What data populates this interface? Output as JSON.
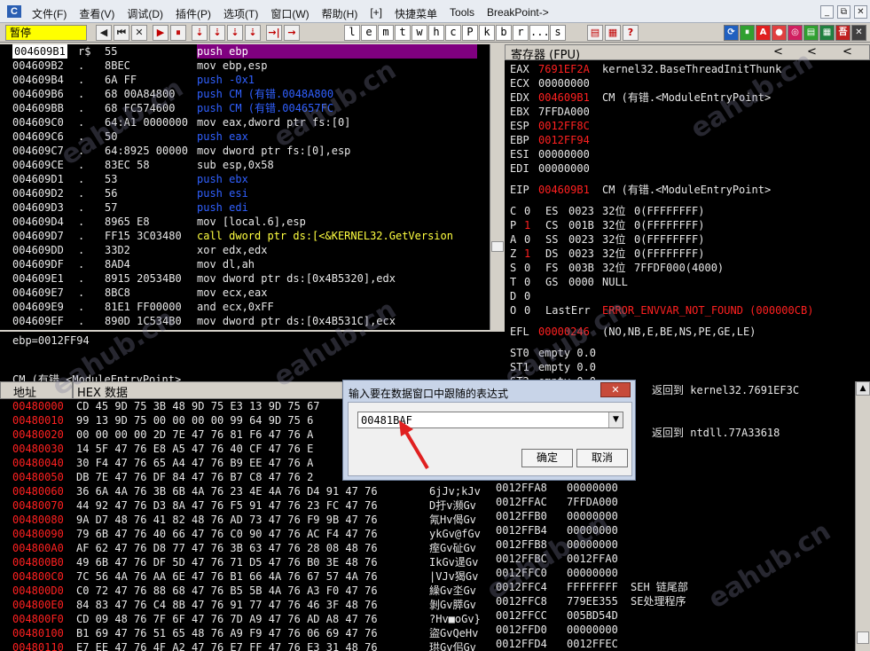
{
  "menubar": {
    "items": [
      "文件(F)",
      "查看(V)",
      "调试(D)",
      "插件(P)",
      "选项(T)",
      "窗口(W)",
      "帮助(H)",
      "[+]",
      "快捷菜单",
      "Tools",
      "BreakPoint->"
    ],
    "window_controls": [
      "_",
      "⧉",
      "✕"
    ]
  },
  "toolbar": {
    "status": "暂停",
    "debug_buttons": [
      "◀",
      "⏮",
      "✕",
      "▶",
      "⏸",
      "⇣",
      "⇣",
      "⇣",
      "⇣",
      "→|",
      "→"
    ],
    "letter_buttons": [
      "l",
      "e",
      "m",
      "t",
      "w",
      "h",
      "c",
      "P",
      "k",
      "b",
      "r",
      "...",
      "s"
    ],
    "tool_buttons": [
      "▤",
      "▦",
      "?"
    ],
    "right_icons": [
      "⟳",
      "⏸",
      "A",
      "●",
      "◎",
      "▤",
      "▦",
      "吾",
      "✕"
    ]
  },
  "disasm": {
    "rows": [
      {
        "addr": "004609B1",
        "mark": "r$",
        "hex": "55",
        "asm": "push ebp"
      },
      {
        "addr": "004609B2",
        "mark": ".",
        "hex": "8BEC",
        "asm": "mov ebp,esp"
      },
      {
        "addr": "004609B4",
        "mark": ".",
        "hex": "6A FF",
        "asm": "push -0x1"
      },
      {
        "addr": "004609B6",
        "mark": ".",
        "hex": "68 00A84800",
        "asm": "push CM (有错.0048A800"
      },
      {
        "addr": "004609BB",
        "mark": ".",
        "hex": "68 FC574600",
        "asm": "push CM (有错.004657FC"
      },
      {
        "addr": "004609C0",
        "mark": ".",
        "hex": "64:A1 0000000",
        "asm": "mov eax,dword ptr fs:[0]"
      },
      {
        "addr": "004609C6",
        "mark": ".",
        "hex": "50",
        "asm": "push eax"
      },
      {
        "addr": "004609C7",
        "mark": ".",
        "hex": "64:8925 00000",
        "asm": "mov dword ptr fs:[0],esp"
      },
      {
        "addr": "004609CE",
        "mark": ".",
        "hex": "83EC 58",
        "asm": "sub esp,0x58"
      },
      {
        "addr": "004609D1",
        "mark": ".",
        "hex": "53",
        "asm": "push ebx"
      },
      {
        "addr": "004609D2",
        "mark": ".",
        "hex": "56",
        "asm": "push esi"
      },
      {
        "addr": "004609D3",
        "mark": ".",
        "hex": "57",
        "asm": "push edi"
      },
      {
        "addr": "004609D4",
        "mark": ".",
        "hex": "8965 E8",
        "asm": "mov [local.6],esp"
      },
      {
        "addr": "004609D7",
        "mark": ".",
        "hex": "FF15 3C03480",
        "asm": "call dword ptr ds:[<&KERNEL32.GetVersion"
      },
      {
        "addr": "004609DD",
        "mark": ".",
        "hex": "33D2",
        "asm": "xor edx,edx"
      },
      {
        "addr": "004609DF",
        "mark": ".",
        "hex": "8AD4",
        "asm": "mov dl,ah"
      },
      {
        "addr": "004609E1",
        "mark": ".",
        "hex": "8915 20534B0",
        "asm": "mov dword ptr ds:[0x4B5320],edx"
      },
      {
        "addr": "004609E7",
        "mark": ".",
        "hex": "8BC8",
        "asm": "mov ecx,eax"
      },
      {
        "addr": "004609E9",
        "mark": ".",
        "hex": "81E1 FF00000",
        "asm": "and ecx,0xFF"
      },
      {
        "addr": "004609EF",
        "mark": ".",
        "hex": "890D 1C534B0",
        "asm": "mov dword ptr ds:[0x4B531C],ecx"
      }
    ],
    "info_line1": "ebp=0012FF94",
    "info_line2": "CM (有错.<ModuleEntryPoint>"
  },
  "registers": {
    "header": "寄存器 (FPU)",
    "arrows": [
      "<",
      "<",
      "<"
    ],
    "gp": [
      {
        "name": "EAX",
        "value": "7691EF2A",
        "comment": "kernel32.BaseThreadInitThunk"
      },
      {
        "name": "ECX",
        "value": "00000000",
        "comment": ""
      },
      {
        "name": "EDX",
        "value": "004609B1",
        "comment": "CM (有错.<ModuleEntryPoint>"
      },
      {
        "name": "EBX",
        "value": "7FFDA000",
        "comment": ""
      },
      {
        "name": "ESP",
        "value": "0012FF8C",
        "comment": ""
      },
      {
        "name": "EBP",
        "value": "0012FF94",
        "comment": ""
      },
      {
        "name": "ESI",
        "value": "00000000",
        "comment": ""
      },
      {
        "name": "EDI",
        "value": "00000000",
        "comment": ""
      }
    ],
    "eip": {
      "name": "EIP",
      "value": "004609B1",
      "comment": "CM (有错.<ModuleEntryPoint>"
    },
    "flags": [
      {
        "flag": "C",
        "bit": "0",
        "seg": "ES",
        "sel": "0023",
        "bits": "32位",
        "base": "0(FFFFFFFF)"
      },
      {
        "flag": "P",
        "bit": "1",
        "seg": "CS",
        "sel": "001B",
        "bits": "32位",
        "base": "0(FFFFFFFF)"
      },
      {
        "flag": "A",
        "bit": "0",
        "seg": "SS",
        "sel": "0023",
        "bits": "32位",
        "base": "0(FFFFFFFF)"
      },
      {
        "flag": "Z",
        "bit": "1",
        "seg": "DS",
        "sel": "0023",
        "bits": "32位",
        "base": "0(FFFFFFFF)"
      },
      {
        "flag": "S",
        "bit": "0",
        "seg": "FS",
        "sel": "003B",
        "bits": "32位",
        "base": "7FFDF000(4000)"
      },
      {
        "flag": "T",
        "bit": "0",
        "seg": "GS",
        "sel": "0000",
        "bits": "NULL",
        "base": ""
      }
    ],
    "d_flag": {
      "flag": "D",
      "bit": "0"
    },
    "o_flag": {
      "flag": "O",
      "bit": "0",
      "label": "LastErr",
      "value": "ERROR_ENVVAR_NOT_FOUND (000000CB)"
    },
    "efl": {
      "name": "EFL",
      "value": "00000246",
      "comment": "(NO,NB,E,BE,NS,PE,GE,LE)"
    },
    "st": [
      {
        "name": "ST0",
        "value": "empty 0.0"
      },
      {
        "name": "ST1",
        "value": "empty 0.0"
      },
      {
        "name": "ST2",
        "value": "empty 0.0"
      }
    ]
  },
  "dump": {
    "col_addr": "地址",
    "col_hex": "HEX 数据",
    "rows": [
      {
        "addr": "00480000",
        "hex": "CD 45 9D 75 3B 48 9D 75 E3 13 9D 75 67",
        "ascii": ""
      },
      {
        "addr": "00480010",
        "hex": "99 13 9D 75 00 00 00 00 99 64 9D 75 6",
        "ascii": ""
      },
      {
        "addr": "00480020",
        "hex": "00 00 00 00 2D 7E 47 76 81 F6 47 76 A",
        "ascii": ""
      },
      {
        "addr": "00480030",
        "hex": "14 5F 47 76 E8 A5 47 76 40 CF 47 76 E",
        "ascii": ""
      },
      {
        "addr": "00480040",
        "hex": "30 F4 47 76 65 A4 47 76 B9 EE 47 76 A",
        "ascii": ""
      },
      {
        "addr": "00480050",
        "hex": "DB 7E 47 76 DF 84 47 76 B7 C8 47 76 2",
        "ascii": ""
      },
      {
        "addr": "00480060",
        "hex": "36 6A 4A 76 3B 6B 4A 76 23 4E 4A 76 D4 91 47 76",
        "ascii": "6jJv;kJv"
      },
      {
        "addr": "00480070",
        "hex": "44 92 47 76 D3 8A 47 76 F5 91 47 76 23 FC 47 76",
        "ascii": "D扜v瀕Gv"
      },
      {
        "addr": "00480080",
        "hex": "9A D7 48 76 41 82 48 76 AD 73 47 76 F9 9B 47 76",
        "ascii": "氝Hv偈Gv"
      },
      {
        "addr": "00480090",
        "hex": "79 6B 47 76 40 66 47 76 C0 90 47 76 AC F4 47 76",
        "ascii": "ykGv@fGv"
      },
      {
        "addr": "004800A0",
        "hex": "AF 62 47 76 D8 77 47 76 3B 63 47 76 28 08 48 76",
        "ascii": "痓Gv砋Gv"
      },
      {
        "addr": "004800B0",
        "hex": "49 6B 47 76 DF 5D 47 76 71 D5 47 76 B0 3E 48 76",
        "ascii": "IkGv遈Gv"
      },
      {
        "addr": "004800C0",
        "hex": "7C 56 4A 76 AA 6E 47 76 B1 66 4A 76 67 57 4A 76",
        "ascii": "|VJv猲Gv"
      },
      {
        "addr": "004800D0",
        "hex": "C0 72 47 76 88 68 47 76 B5 5B 4A 76 A3 F0 47 76",
        "ascii": "繰Gv坔Gv"
      },
      {
        "addr": "004800E0",
        "hex": "84 83 47 76 C4 8B 47 76 91 77 47 76 46 3F 48 76",
        "ascii": "剝Gv膵Gv"
      },
      {
        "addr": "004800F0",
        "hex": "CD 09 48 76 7F 6F 47 76 7D A9 47 76 AD A8 47 76",
        "ascii": "?Hv■oGv}"
      },
      {
        "addr": "00480100",
        "hex": "B1 69 47 76 51 65 48 76 A9 F9 47 76 06 69 47 76",
        "ascii": "盜GvQeHv"
      },
      {
        "addr": "00480110",
        "hex": "E7 EE 47 76 4F A2 47 76 E7 FF 47 76 E3 31 48 76",
        "ascii": "珙Gv佀Gv"
      }
    ]
  },
  "stack": {
    "top_lines": [
      "返回到 kernel32.7691EF3C",
      "返回到 ntdll.77A33618"
    ],
    "rows": [
      {
        "addr": "0012FFA8",
        "value": "00000000",
        "comment": ""
      },
      {
        "addr": "0012FFAC",
        "value": "7FFDA000",
        "comment": ""
      },
      {
        "addr": "0012FFB0",
        "value": "00000000",
        "comment": ""
      },
      {
        "addr": "0012FFB4",
        "value": "00000000",
        "comment": ""
      },
      {
        "addr": "0012FFB8",
        "value": "00000000",
        "comment": ""
      },
      {
        "addr": "0012FFBC",
        "value": "0012FFA0",
        "comment": ""
      },
      {
        "addr": "0012FFC0",
        "value": "00000000",
        "comment": ""
      },
      {
        "addr": "0012FFC4",
        "value": "FFFFFFFF",
        "comment": "SEH 链尾部"
      },
      {
        "addr": "0012FFC8",
        "value": "779EE355",
        "comment": "SE处理程序"
      },
      {
        "addr": "0012FFCC",
        "value": "005BD54D",
        "comment": ""
      },
      {
        "addr": "0012FFD0",
        "value": "00000000",
        "comment": ""
      },
      {
        "addr": "0012FFD4",
        "value": "0012FFEC",
        "comment": ""
      }
    ]
  },
  "dialog": {
    "title": "输入要在数据窗口中跟随的表达式",
    "close": "✕",
    "input_value": "00481BAF",
    "ok": "确定",
    "cancel": "取消"
  },
  "watermark": "eahub.cn",
  "colors": {
    "status": "#ffff00",
    "selected_row": "#800080",
    "register_changed": "#ff2020",
    "arrow": "#e02020"
  }
}
